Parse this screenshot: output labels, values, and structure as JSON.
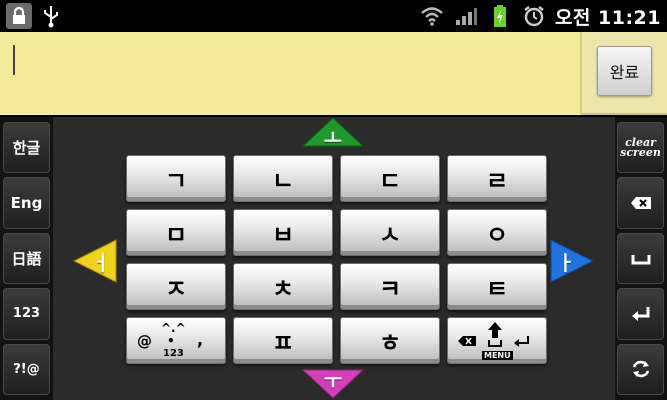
{
  "status_bar": {
    "time": "오전 11:21",
    "icons": [
      "lock-icon",
      "usb-icon",
      "wifi-icon",
      "signal-icon",
      "battery-icon",
      "alarm-icon"
    ]
  },
  "input": {
    "value": "",
    "done_label": "완료"
  },
  "left_column": [
    {
      "id": "korean",
      "label": "한글"
    },
    {
      "id": "english",
      "label": "Eng"
    },
    {
      "id": "japanese",
      "label": "日語"
    },
    {
      "id": "numbers",
      "label": "123"
    },
    {
      "id": "symbols",
      "label": "?!@"
    }
  ],
  "right_column": {
    "clear_line1": "clear",
    "clear_line2": "screen",
    "icons": [
      "backspace-icon",
      "space-icon",
      "enter-icon",
      "rotate-icon"
    ]
  },
  "grid_keys": [
    [
      "ㄱ",
      "ㄴ",
      "ㄷ",
      "ㄹ"
    ],
    [
      "ㅁ",
      "ㅂ",
      "ㅅ",
      "ㅇ"
    ],
    [
      "ㅈ",
      "ㅊ",
      "ㅋ",
      "ㅌ"
    ],
    [
      "",
      "ㅍ",
      "ㅎ",
      ""
    ]
  ],
  "special_key_emoticon": {
    "at": "@",
    "face": "^.^",
    "dot": "•",
    "comma": ",",
    "num": "123"
  },
  "special_key_edit": {
    "menu": "MENU"
  },
  "vowels": {
    "up": "ㅗ",
    "down": "ㅜ",
    "left": "ㅓ",
    "right": "ㅏ"
  },
  "colors": {
    "up": "#1f9a2a",
    "down": "#d43fb8",
    "left": "#f1d21b",
    "right": "#1f74e0"
  }
}
